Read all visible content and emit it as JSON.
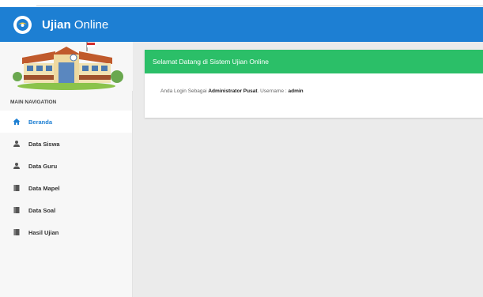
{
  "app": {
    "title_bold": "Ujian",
    "title_rest": " Online"
  },
  "sidebar": {
    "nav_header": "MAIN NAVIGATION",
    "items": [
      {
        "label": "Beranda",
        "icon": "home-icon",
        "active": true
      },
      {
        "label": "Data Siswa",
        "icon": "user-icon",
        "active": false
      },
      {
        "label": "Data Guru",
        "icon": "user-icon",
        "active": false
      },
      {
        "label": "Data Mapel",
        "icon": "book-icon",
        "active": false
      },
      {
        "label": "Data Soal",
        "icon": "book-icon",
        "active": false
      },
      {
        "label": "Hasil Ujian",
        "icon": "book-icon",
        "active": false
      }
    ]
  },
  "welcome": {
    "title": "Selamat Datang di Sistem Ujian Online",
    "login_prefix": "Anda Login Sebagai ",
    "role": "Administrator Pusat",
    "username_prefix": ". Username : ",
    "username": "admin"
  },
  "colors": {
    "primary": "#1d7fd3",
    "success": "#2bbf68"
  }
}
